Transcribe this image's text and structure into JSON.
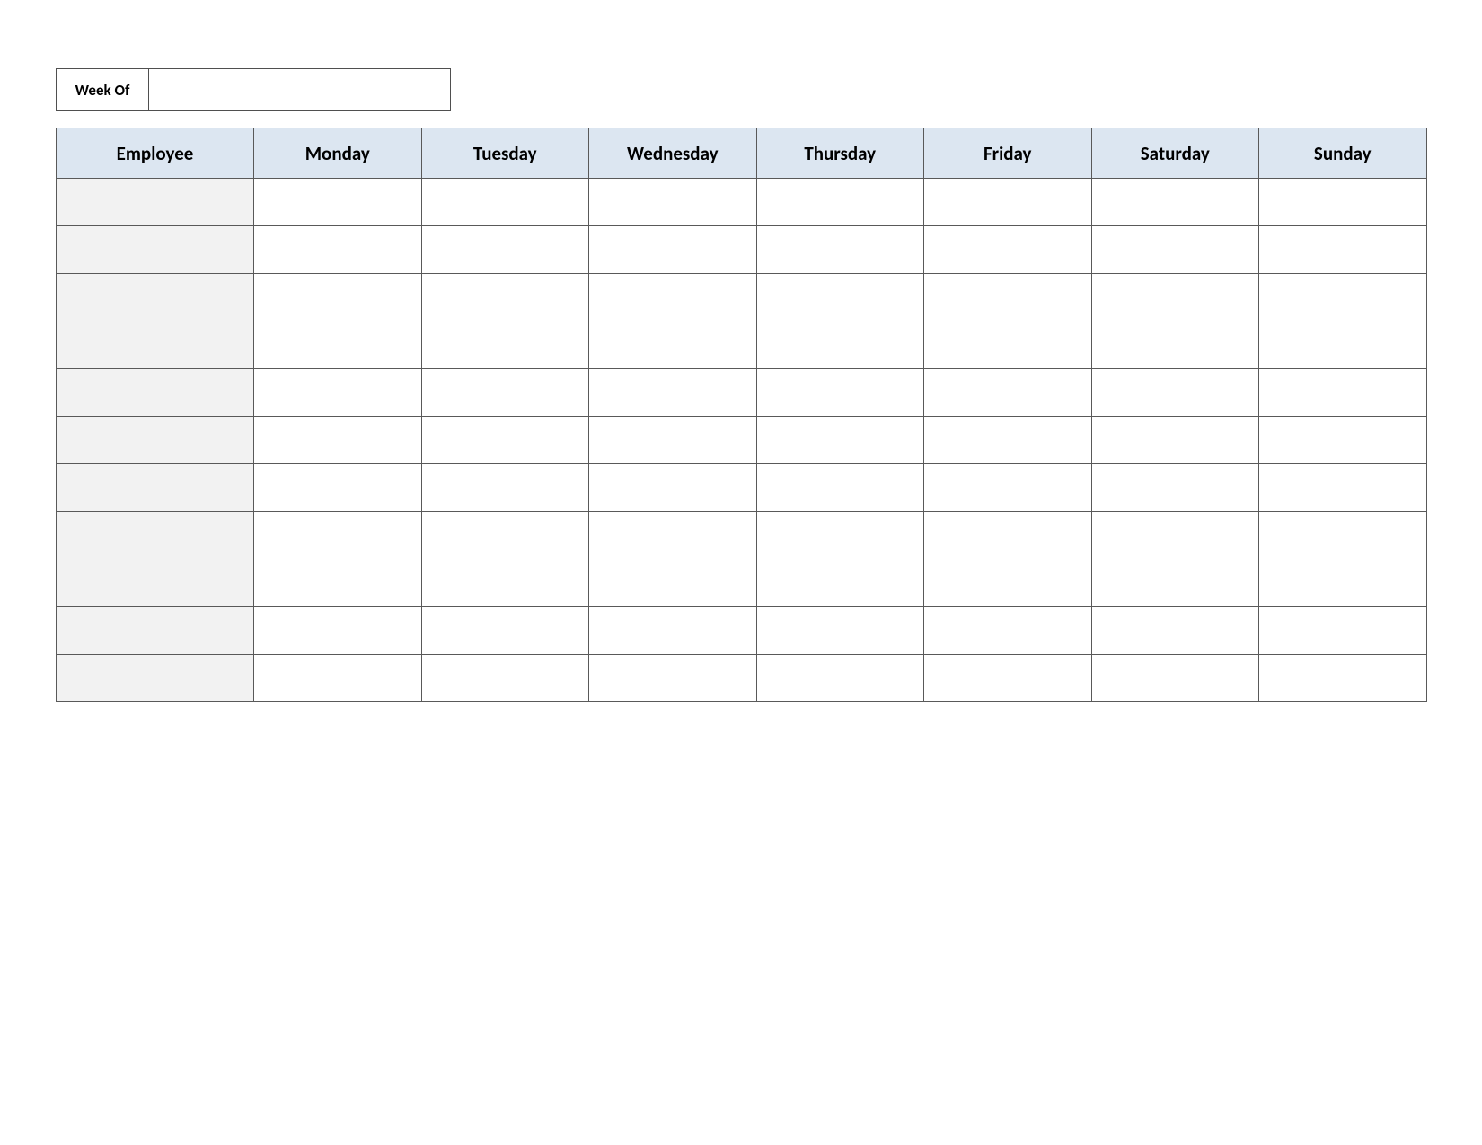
{
  "week_of": {
    "label": "Week Of",
    "value": ""
  },
  "headers": {
    "employee": "Employee",
    "days": [
      "Monday",
      "Tuesday",
      "Wednesday",
      "Thursday",
      "Friday",
      "Saturday",
      "Sunday"
    ]
  },
  "rows": [
    {
      "employee": "",
      "cells": [
        "",
        "",
        "",
        "",
        "",
        "",
        ""
      ]
    },
    {
      "employee": "",
      "cells": [
        "",
        "",
        "",
        "",
        "",
        "",
        ""
      ]
    },
    {
      "employee": "",
      "cells": [
        "",
        "",
        "",
        "",
        "",
        "",
        ""
      ]
    },
    {
      "employee": "",
      "cells": [
        "",
        "",
        "",
        "",
        "",
        "",
        ""
      ]
    },
    {
      "employee": "",
      "cells": [
        "",
        "",
        "",
        "",
        "",
        "",
        ""
      ]
    },
    {
      "employee": "",
      "cells": [
        "",
        "",
        "",
        "",
        "",
        "",
        ""
      ]
    },
    {
      "employee": "",
      "cells": [
        "",
        "",
        "",
        "",
        "",
        "",
        ""
      ]
    },
    {
      "employee": "",
      "cells": [
        "",
        "",
        "",
        "",
        "",
        "",
        ""
      ]
    },
    {
      "employee": "",
      "cells": [
        "",
        "",
        "",
        "",
        "",
        "",
        ""
      ]
    },
    {
      "employee": "",
      "cells": [
        "",
        "",
        "",
        "",
        "",
        "",
        ""
      ]
    },
    {
      "employee": "",
      "cells": [
        "",
        "",
        "",
        "",
        "",
        "",
        ""
      ]
    }
  ]
}
